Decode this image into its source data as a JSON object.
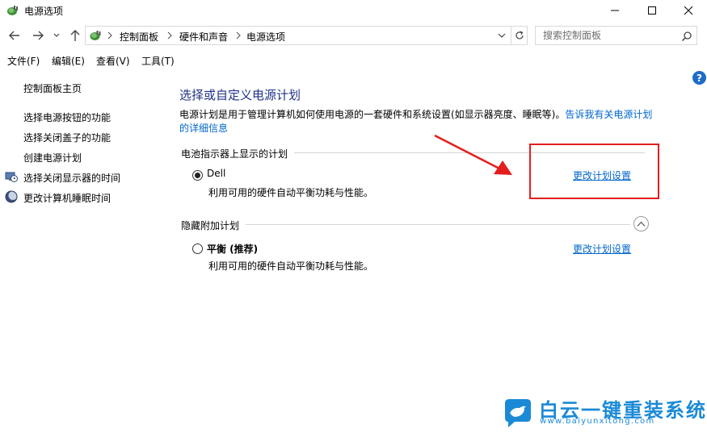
{
  "window": {
    "title": "电源选项",
    "icon": "power-options-icon"
  },
  "address_bar": {
    "breadcrumbs": [
      "控制面板",
      "硬件和声音",
      "电源选项"
    ],
    "search_placeholder": "搜索控制面板"
  },
  "menu": {
    "file": "文件(F)",
    "edit": "编辑(E)",
    "view": "查看(V)",
    "tools": "工具(T)"
  },
  "sidebar": {
    "home": "控制面板主页",
    "items": [
      {
        "label": "选择电源按钮的功能",
        "icon": ""
      },
      {
        "label": "选择关闭盖子的功能",
        "icon": ""
      },
      {
        "label": "创建电源计划",
        "icon": ""
      },
      {
        "label": "选择关闭显示器的时间",
        "icon": "monitor-clock-icon"
      },
      {
        "label": "更改计算机睡眠时间",
        "icon": "moon-icon"
      }
    ]
  },
  "main": {
    "title": "选择或自定义电源计划",
    "description": "电源计划是用于管理计算机如何使用电源的一套硬件和系统设置(如显示器亮度、睡眠等)。",
    "description_link": "告诉我有关电源计划的详细信息",
    "battery_section": "电池指示器上显示的计划",
    "hidden_section": "隐藏附加计划",
    "plans": [
      {
        "name": "Dell",
        "desc": "利用可用的硬件自动平衡功耗与性能。",
        "link": "更改计划设置",
        "selected": true
      },
      {
        "name": "平衡 (推荐)",
        "desc": "利用可用的硬件自动平衡功耗与性能。",
        "link": "更改计划设置",
        "selected": false
      }
    ]
  },
  "watermark": {
    "brand": "白云一键重装系统",
    "url": "www.baiyunxitong.com"
  },
  "colors": {
    "title_blue": "#1e3287",
    "link_blue": "#0066cc",
    "annotation_red": "#e41e1e",
    "watermark_blue": "#1b8ad6"
  }
}
